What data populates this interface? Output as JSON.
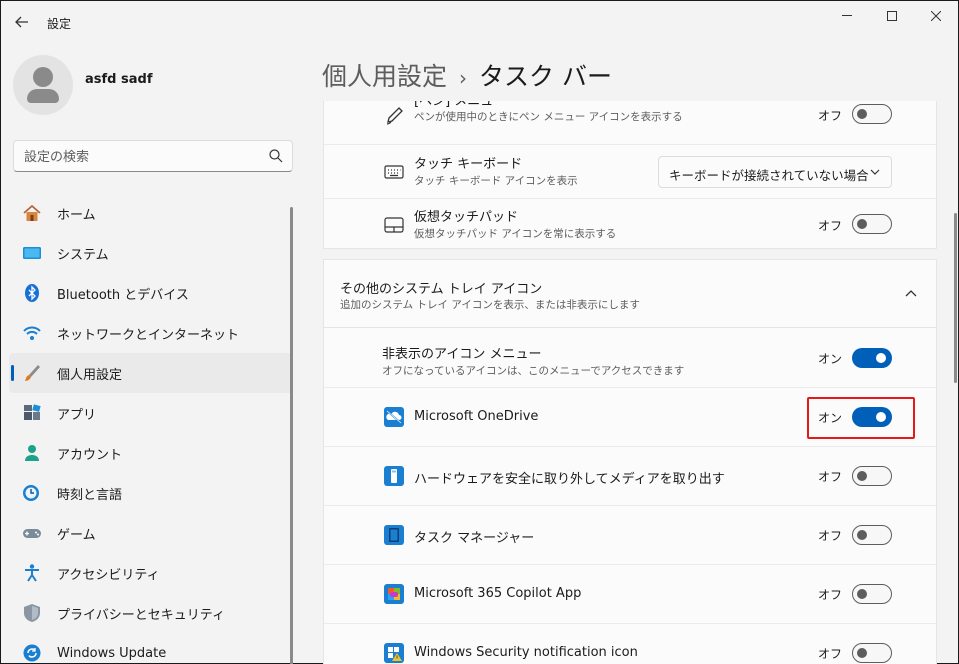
{
  "window": {
    "title": "設定",
    "controls": {
      "minimize": "—",
      "maximize": "☐",
      "close": "✕"
    },
    "back_icon": "arrow-left-icon"
  },
  "sidebar": {
    "user_name": "asfd sadf",
    "search_placeholder": "設定の検索",
    "items": [
      {
        "label": "ホーム",
        "icon": "home-icon"
      },
      {
        "label": "システム",
        "icon": "monitor-icon"
      },
      {
        "label": "Bluetooth とデバイス",
        "icon": "bluetooth-icon"
      },
      {
        "label": "ネットワークとインターネット",
        "icon": "wifi-icon"
      },
      {
        "label": "個人用設定",
        "icon": "brush-icon",
        "selected": true
      },
      {
        "label": "アプリ",
        "icon": "apps-icon"
      },
      {
        "label": "アカウント",
        "icon": "account-icon"
      },
      {
        "label": "時刻と言語",
        "icon": "clock-globe-icon"
      },
      {
        "label": "ゲーム",
        "icon": "gamepad-icon"
      },
      {
        "label": "アクセシビリティ",
        "icon": "accessibility-icon"
      },
      {
        "label": "プライバシーとセキュリティ",
        "icon": "shield-icon"
      },
      {
        "label": "Windows Update",
        "icon": "update-icon"
      }
    ]
  },
  "breadcrumb": {
    "parent": "個人用設定",
    "separator": "›",
    "current": "タスク バー"
  },
  "pen_card": [
    {
      "title": "[ペン] メニュー",
      "subtitle": "ペンが使用中のときにペン メニュー アイコンを表示する",
      "state_label": "オフ",
      "on": false,
      "icon": "pen-icon"
    },
    {
      "title": "タッチ キーボード",
      "subtitle": "タッチ キーボード アイコンを表示",
      "dropdown_value": "キーボードが接続されていない場合",
      "icon": "keyboard-icon"
    },
    {
      "title": "仮想タッチパッド",
      "subtitle": "仮想タッチパッド アイコンを常に表示する",
      "state_label": "オフ",
      "on": false,
      "icon": "touchpad-icon"
    }
  ],
  "tray_section": {
    "title": "その他のシステム トレイ アイコン",
    "subtitle": "追加のシステム トレイ アイコンを表示、または非表示にします",
    "hidden_menu": {
      "title": "非表示のアイコン メニュー",
      "subtitle": "オフになっているアイコンは、このメニューでアクセスできます",
      "state_label": "オン",
      "on": true
    },
    "apps": [
      {
        "name": "Microsoft OneDrive",
        "state_label": "オン",
        "on": true,
        "icon": "onedrive-icon"
      },
      {
        "name": "ハードウェアを安全に取り外してメディアを取り出す",
        "state_label": "オフ",
        "on": false,
        "icon": "usb-drive-icon"
      },
      {
        "name": "タスク マネージャー",
        "state_label": "オフ",
        "on": false,
        "icon": "task-manager-icon"
      },
      {
        "name": "Microsoft 365 Copilot App",
        "state_label": "オフ",
        "on": false,
        "icon": "copilot-app-icon"
      },
      {
        "name": "Windows Security notification icon",
        "state_label": "オフ",
        "on": false,
        "icon": "windows-security-icon"
      }
    ]
  },
  "colors": {
    "accent": "#005fb8",
    "highlight_box": "#e41a1a",
    "background": "#f3f3f3",
    "card": "#fbfbfb"
  }
}
